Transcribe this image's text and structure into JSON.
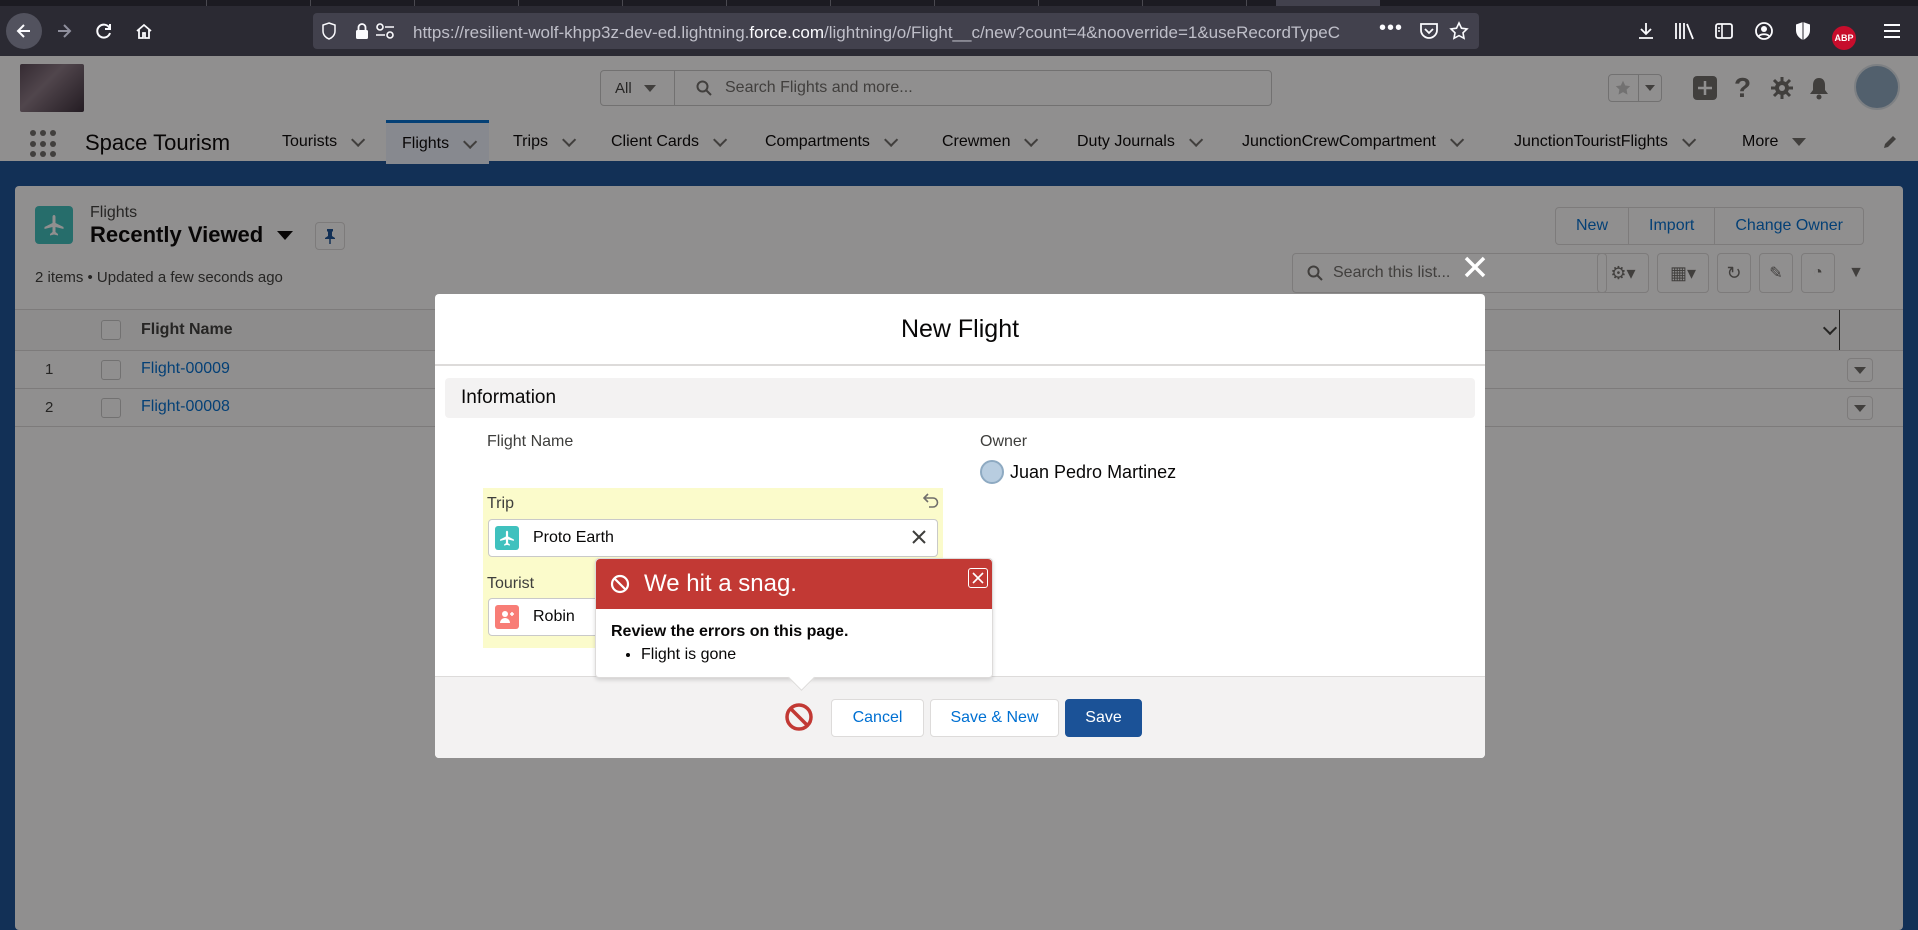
{
  "browser": {
    "url_host_pre": "https://resilient-wolf-khpp3z-dev-ed.lightning.",
    "url_host_main": "force.com",
    "url_path": "/lightning/o/Flight__c/new?count=4&nooverride=1&useRecordTypeC",
    "abp_label": "ABP"
  },
  "header": {
    "search_scope": "All",
    "search_placeholder": "Search Flights and more..."
  },
  "nav": {
    "app_name": "Space Tourism",
    "items": [
      {
        "label": "Tourists"
      },
      {
        "label": "Flights"
      },
      {
        "label": "Trips"
      },
      {
        "label": "Client Cards"
      },
      {
        "label": "Compartments"
      },
      {
        "label": "Crewmen"
      },
      {
        "label": "Duty Journals"
      },
      {
        "label": "JunctionCrewCompartment"
      },
      {
        "label": "JunctionTouristFlights"
      },
      {
        "label": "More"
      }
    ]
  },
  "list": {
    "object_label": "Flights",
    "view_name": "Recently Viewed",
    "meta": "2 items • Updated a few seconds ago",
    "buttons": [
      "New",
      "Import",
      "Change Owner"
    ],
    "search_placeholder": "Search this list...",
    "column": "Flight Name",
    "rows": [
      {
        "num": "1",
        "name": "Flight-00009"
      },
      {
        "num": "2",
        "name": "Flight-00008"
      }
    ]
  },
  "modal": {
    "title": "New Flight",
    "section": "Information",
    "flight_name_label": "Flight Name",
    "owner_label": "Owner",
    "owner_value": "Juan Pedro Martinez",
    "trip_label": "Trip",
    "trip_value": "Proto Earth",
    "tourist_label": "Tourist",
    "tourist_value": "Robin",
    "cancel": "Cancel",
    "save_new": "Save & New",
    "save": "Save"
  },
  "error": {
    "heading": "We hit a snag.",
    "title": "Review the errors on this page.",
    "items": [
      "Flight is gone"
    ]
  },
  "colors": {
    "brand": "#1b5297",
    "link": "#0070d2",
    "error": "#c23934",
    "flight_icon": "#3fc1be",
    "tourist_icon": "#f87d76",
    "dirty_field": "#fbfbcb"
  }
}
